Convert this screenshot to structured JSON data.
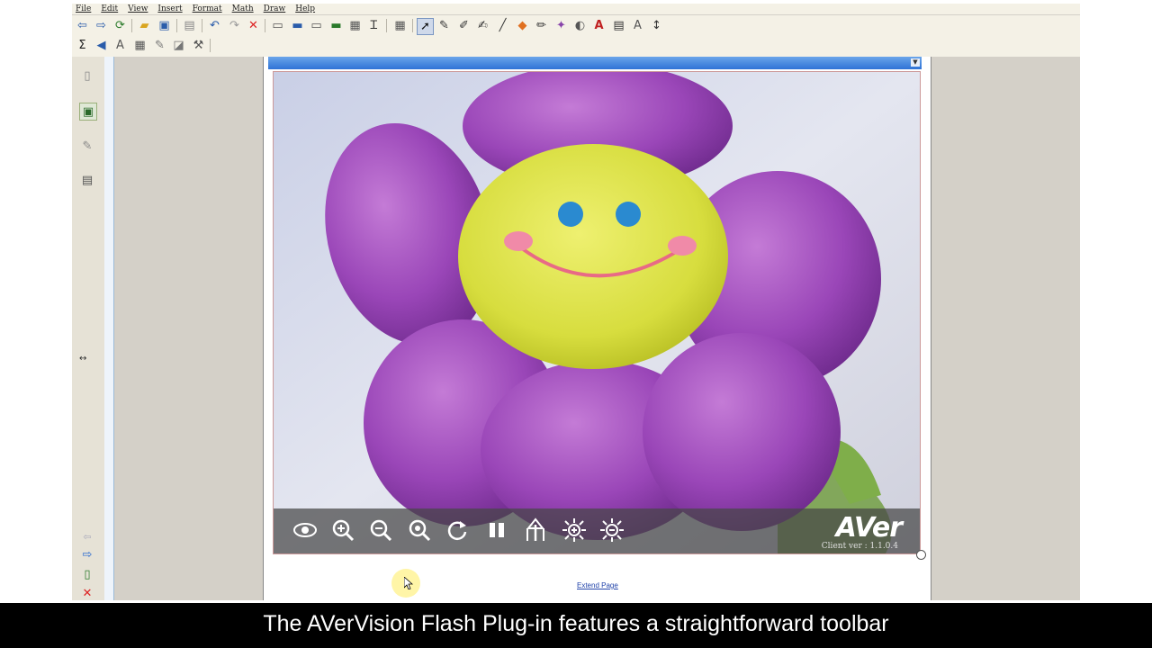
{
  "menu": [
    "File",
    "Edit",
    "View",
    "Insert",
    "Format",
    "Math",
    "Draw",
    "Help"
  ],
  "toolbar_icons": {
    "row1": [
      "back-arrow-icon",
      "forward-arrow-icon",
      "refresh-page-icon",
      "open-folder-icon",
      "save-icon",
      "print-preview-icon",
      "undo-icon",
      "redo-icon",
      "delete-icon",
      "screen-icon",
      "monitor-icon",
      "display-icon",
      "desktop-icon",
      "image-frame-icon",
      "text-frame-icon",
      "table-icon",
      "select-arrow-icon",
      "pen-icon",
      "pencil-icon",
      "highlighter-icon",
      "line-icon",
      "fill-icon",
      "brush-icon",
      "magic-wand-icon",
      "eraser-icon",
      "text-color-icon",
      "text-box-icon",
      "font-icon",
      "line-spacing-icon"
    ],
    "row2": [
      "sigma-icon",
      "shape-icon",
      "handwriting-icon",
      "table-edit-icon",
      "edit-icon",
      "eraser2-icon",
      "tools-icon"
    ]
  },
  "left_panel_icons": [
    "new-page-icon",
    "image-gallery-icon",
    "attachment-icon",
    "text-tool-icon"
  ],
  "left_bottom_icons": [
    "prev-arrow-icon",
    "next-arrow-icon",
    "add-page-icon",
    "close-icon"
  ],
  "plugin": {
    "logo": "AVer",
    "client_version": "Client ver : 1.1.0.4",
    "controls": [
      "eye-icon",
      "zoom-in-icon",
      "zoom-out-icon",
      "zoom-1x-icon",
      "rotate-icon",
      "pause-icon",
      "auto-focus-icon",
      "brightness-up-icon",
      "brightness-down-icon"
    ]
  },
  "extend_link": "Extend Page",
  "caption": "The AVerVision Flash Plug-in features a straightforward toolbar"
}
